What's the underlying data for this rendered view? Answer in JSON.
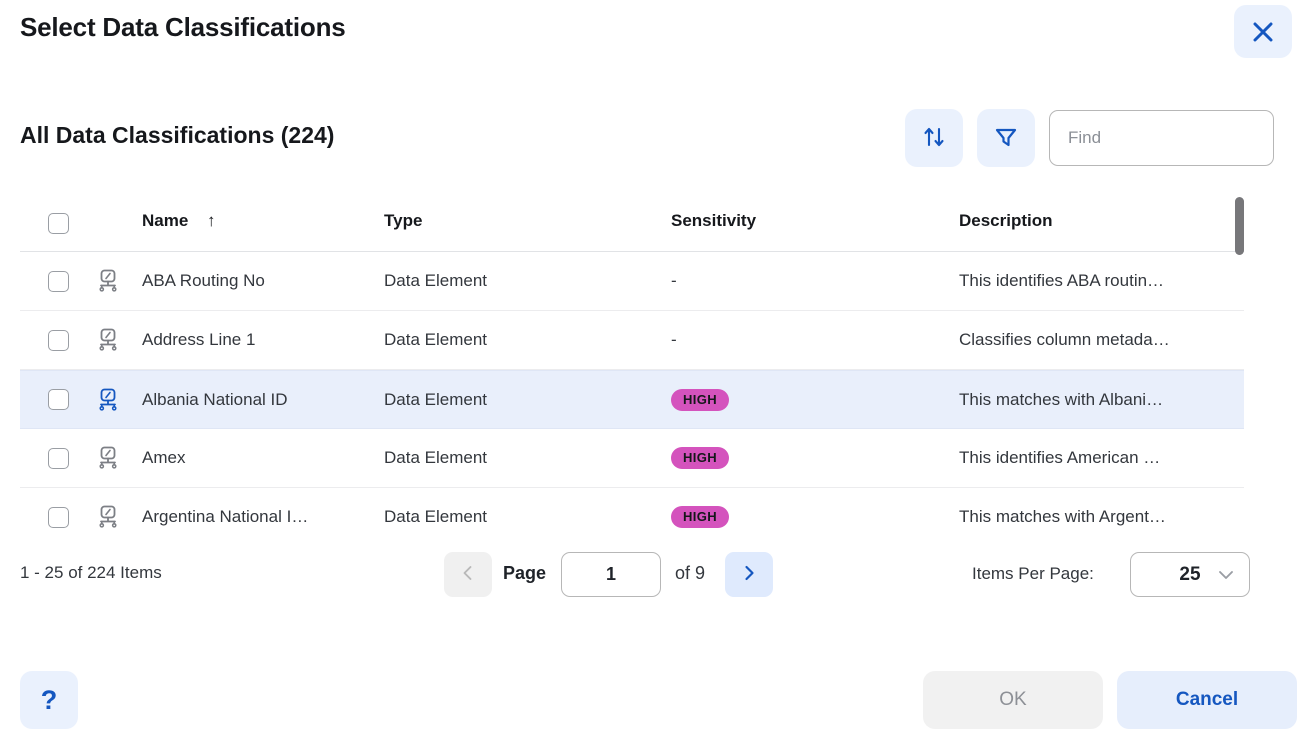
{
  "dialog": {
    "title": "Select Data Classifications",
    "close_icon": "close-icon"
  },
  "toolbar": {
    "section_title": "All Data Classifications (224)",
    "sort_icon": "sort-arrows-icon",
    "filter_icon": "funnel-icon",
    "find_placeholder": "Find",
    "find_value": ""
  },
  "table": {
    "columns": [
      {
        "key": "name",
        "label": "Name",
        "sort_indicator": "↑"
      },
      {
        "key": "type",
        "label": "Type",
        "sort_indicator": ""
      },
      {
        "key": "sensitivity",
        "label": "Sensitivity",
        "sort_indicator": ""
      },
      {
        "key": "description",
        "label": "Description",
        "sort_indicator": ""
      }
    ],
    "select_all_checked": false,
    "rows": [
      {
        "name": "ABA Routing No",
        "type": "Data Element",
        "sensitivity": "-",
        "description": "This identifies ABA routin…",
        "checked": false,
        "selected": false,
        "icon": "data-element-icon"
      },
      {
        "name": "Address Line 1",
        "type": "Data Element",
        "sensitivity": "-",
        "description": "Classifies column metada…",
        "checked": false,
        "selected": false,
        "icon": "data-element-icon"
      },
      {
        "name": "Albania National ID",
        "type": "Data Element",
        "sensitivity": "HIGH",
        "description": "This matches with Albani…",
        "checked": false,
        "selected": true,
        "icon": "data-element-icon"
      },
      {
        "name": "Amex",
        "type": "Data Element",
        "sensitivity": "HIGH",
        "description": "This identifies American …",
        "checked": false,
        "selected": false,
        "icon": "data-element-icon"
      },
      {
        "name": "Argentina National I…",
        "type": "Data Element",
        "sensitivity": "HIGH",
        "description": "This matches with Argent…",
        "checked": false,
        "selected": false,
        "icon": "data-element-icon"
      }
    ]
  },
  "pagination": {
    "range_text": "1 - 25 of 224 Items",
    "page_word": "Page",
    "page_value": "1",
    "of_text": "of  9",
    "prev_icon": "chevron-left-icon",
    "next_icon": "chevron-right-icon",
    "items_per_page_label": "Items Per Page:",
    "items_per_page_value": "25",
    "items_per_page_chevron": "chevron-down-icon"
  },
  "footer": {
    "help_label": "?",
    "ok_label": "OK",
    "cancel_label": "Cancel"
  },
  "colors": {
    "accent_blue": "#1557c0",
    "accent_blue_soft": "#eaf1fd",
    "row_selected": "#e9effb",
    "badge_high": "#d453bd",
    "border": "#e1e3e6",
    "text": "#33373d"
  }
}
